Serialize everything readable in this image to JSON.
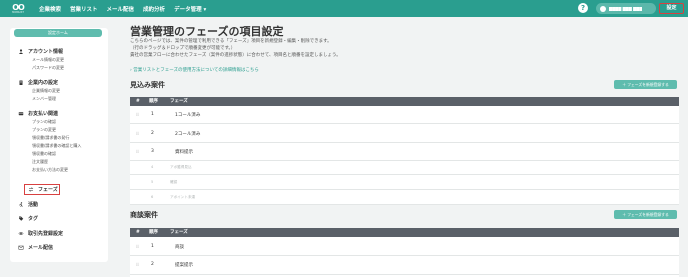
{
  "topnav": {
    "logo_mark": "OO",
    "logo_text": "MOBILIST",
    "items": [
      "企業検索",
      "営業リスト",
      "メール配信",
      "成約分析",
      "データ管理 ▾"
    ],
    "help": "?",
    "user_name": "████ ███ ███",
    "settings_label": "設定"
  },
  "sidebar": {
    "header": "設定ホーム",
    "sections": [
      {
        "label": "アカウント情報",
        "icon": "person-icon",
        "subs": [
          "メール情報の変更",
          "パスワードの変更"
        ]
      },
      {
        "label": "企業内の設定",
        "icon": "building-icon",
        "subs": [
          "企業情報の変更",
          "メンバー管理"
        ]
      },
      {
        "label": "お支払い関連",
        "icon": "card-icon",
        "subs": [
          "プランの確認",
          "プランの変更",
          "領収書/請求書の発行",
          "領収書/請求書の確認と購入",
          "領収書の確認",
          "注文履歴",
          "お支払い方法の変更"
        ]
      }
    ],
    "nav": [
      {
        "label": "フェーズ",
        "icon": "arrows-icon",
        "active": true
      },
      {
        "label": "活動",
        "icon": "run-icon"
      },
      {
        "label": "タグ",
        "icon": "tag-icon"
      },
      {
        "label": "取引先登録設定",
        "icon": "eye-icon"
      },
      {
        "label": "メール配信",
        "icon": "mail-icon"
      }
    ]
  },
  "main": {
    "title": "営業管理のフェーズの項目設定",
    "desc": [
      "こちらのページでは、案件の管理で利用できる「フェーズ」項目を新規登録・編集・削除できます。",
      "（行のドラッグ＆ドロップで順番変更が可能です。）",
      "貴社の営業フローに合わせたフェーズ（案件の進捗状態）に合わせて、項目名と順番を設定しましょう。"
    ],
    "link": "› 営業リストとフェーズの使用方法についての詳細情報はこちら",
    "sections": [
      {
        "title": "見込み案件",
        "add_label": "＋ フェーズを新規登録する",
        "headers": [
          "順序",
          "フェーズ"
        ],
        "rows": [
          {
            "order": "1",
            "phase": "1コール済み"
          },
          {
            "order": "2",
            "phase": "2コール済み"
          },
          {
            "order": "3",
            "phase": "資料提示"
          }
        ],
        "disabled_rows": [
          {
            "order": "4",
            "phase": "アポ獲得見込"
          },
          {
            "order": "5",
            "phase": "確認"
          },
          {
            "order": "6",
            "phase": "アポイント未達"
          }
        ]
      },
      {
        "title": "商談案件",
        "add_label": "＋ フェーズを新規登録する",
        "headers": [
          "順序",
          "フェーズ"
        ],
        "rows": [
          {
            "order": "1",
            "phase": "商談"
          },
          {
            "order": "2",
            "phase": "提案提示"
          }
        ]
      }
    ]
  }
}
